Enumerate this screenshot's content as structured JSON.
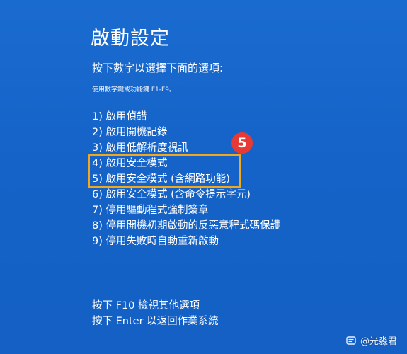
{
  "header": {
    "title": "啟動設定",
    "subtitle": "按下數字以選擇下面的選項:",
    "hint": "使用數字鍵或功能鍵 F1-F9。"
  },
  "options": [
    {
      "label": "1) 啟用偵錯"
    },
    {
      "label": "2) 啟用開機記錄"
    },
    {
      "label": "3) 啟用低解析度視訊"
    },
    {
      "label": "4) 啟用安全模式"
    },
    {
      "label": "5) 啟用安全模式 (含網路功能)"
    },
    {
      "label": "6) 啟用安全模式 (含命令提示字元)"
    },
    {
      "label": "7) 停用驅動程式強制簽章"
    },
    {
      "label": "8) 停用開機初期啟動的反惡意程式碼保護"
    },
    {
      "label": "9) 停用失敗時自動重新啟動"
    }
  ],
  "annotation": {
    "step_number": "5",
    "highlight_color": "#f0a81e",
    "badge_color": "#e83a35"
  },
  "footer": {
    "more_options": "按下 F10 檢視其他選項",
    "return": "按下 Enter 以返回作業系統"
  },
  "watermark": {
    "icon": "toutiao-icon",
    "text": "@光淼君"
  },
  "colors": {
    "background": "#1565c9",
    "text": "#ffffff"
  }
}
